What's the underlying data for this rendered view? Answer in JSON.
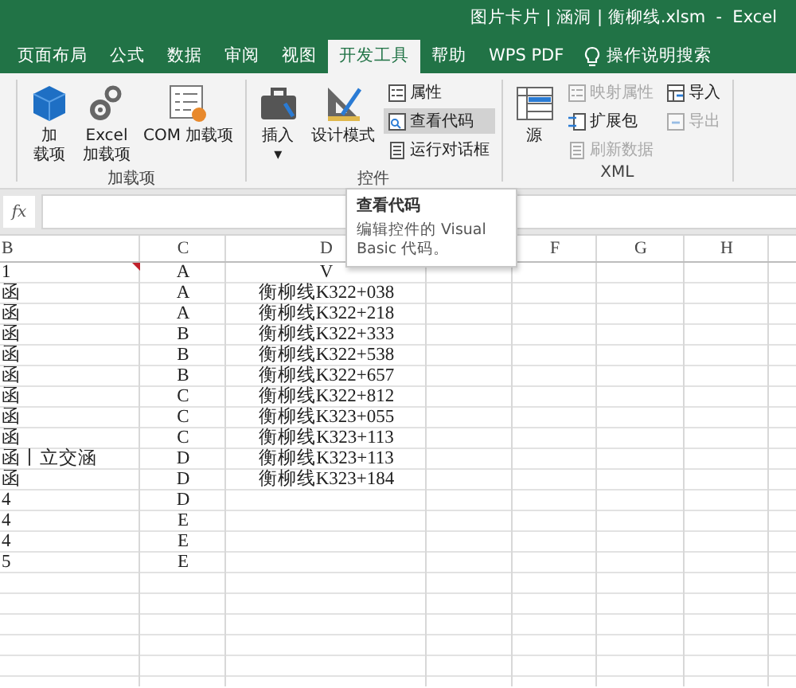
{
  "window": {
    "title": "图片卡片 | 涵洞 | 衡柳线.xlsm  -  Excel"
  },
  "tabs": [
    {
      "label": "页面布局",
      "selected": false
    },
    {
      "label": "公式",
      "selected": false
    },
    {
      "label": "数据",
      "selected": false
    },
    {
      "label": "审阅",
      "selected": false
    },
    {
      "label": "视图",
      "selected": false
    },
    {
      "label": "开发工具",
      "selected": true
    },
    {
      "label": "帮助",
      "selected": false
    },
    {
      "label": "WPS PDF",
      "selected": false
    }
  ],
  "search": {
    "label": "操作说明搜索"
  },
  "ribbon": {
    "groups": [
      {
        "label": "加载项",
        "columns": [
          [
            {
              "kind": "large",
              "lines": [
                "加",
                "载项"
              ],
              "disabled": false,
              "highlighted": false
            }
          ],
          [
            {
              "kind": "large",
              "lines": [
                "Excel",
                "加载项"
              ],
              "disabled": false,
              "highlighted": false
            }
          ],
          [
            {
              "kind": "large",
              "lines": [
                "COM 加载项"
              ],
              "disabled": false,
              "highlighted": false
            }
          ]
        ]
      },
      {
        "label": "控件",
        "columns": [
          [
            {
              "kind": "large",
              "lines": [
                "插入",
                "▾"
              ],
              "disabled": false,
              "highlighted": false
            }
          ],
          [
            {
              "kind": "large",
              "lines": [
                "设计模式"
              ],
              "disabled": false,
              "highlighted": false
            }
          ],
          [
            {
              "kind": "small",
              "lines": [
                "属性"
              ],
              "disabled": false,
              "highlighted": false
            },
            {
              "kind": "small",
              "lines": [
                "查看代码"
              ],
              "disabled": false,
              "highlighted": true
            },
            {
              "kind": "small",
              "lines": [
                "运行对话框"
              ],
              "disabled": false,
              "highlighted": false
            }
          ]
        ]
      },
      {
        "label": "XML",
        "columns": [
          [
            {
              "kind": "large",
              "lines": [
                "源"
              ],
              "disabled": false,
              "highlighted": false
            }
          ],
          [
            {
              "kind": "small",
              "lines": [
                "映射属性"
              ],
              "disabled": true,
              "highlighted": false
            },
            {
              "kind": "small",
              "lines": [
                "扩展包"
              ],
              "disabled": false,
              "highlighted": false
            },
            {
              "kind": "small",
              "lines": [
                "刷新数据"
              ],
              "disabled": true,
              "highlighted": false
            }
          ],
          [
            {
              "kind": "small",
              "lines": [
                "导入"
              ],
              "disabled": false,
              "highlighted": false
            },
            {
              "kind": "small",
              "lines": [
                "导出"
              ],
              "disabled": true,
              "highlighted": false
            }
          ]
        ]
      }
    ]
  },
  "formula_bar": {
    "fx": "fx"
  },
  "tooltip": {
    "title": "查看代码",
    "text": "编辑控件的 Visual Basic 代码。"
  },
  "sheet": {
    "columns": [
      {
        "label": "B"
      },
      {
        "label": "C"
      },
      {
        "label": "D"
      },
      {},
      {
        "label": "F"
      },
      {
        "label": "G"
      },
      {
        "label": "H"
      }
    ],
    "rows": [
      {
        "cells": [
          "1",
          "A",
          "V"
        ],
        "comment": true
      },
      {
        "cells": [
          "函",
          "A",
          "衡柳线K322+038"
        ],
        "comment": false
      },
      {
        "cells": [
          "函",
          "A",
          "衡柳线K322+218"
        ],
        "comment": false
      },
      {
        "cells": [
          "函",
          "B",
          "衡柳线K322+333"
        ],
        "comment": false
      },
      {
        "cells": [
          "函",
          "B",
          "衡柳线K322+538"
        ],
        "comment": false
      },
      {
        "cells": [
          "函",
          "B",
          "衡柳线K322+657"
        ],
        "comment": false
      },
      {
        "cells": [
          "函",
          "C",
          "衡柳线K322+812"
        ],
        "comment": false
      },
      {
        "cells": [
          "函",
          "C",
          "衡柳线K323+055"
        ],
        "comment": false
      },
      {
        "cells": [
          "函",
          "C",
          "衡柳线K323+113"
        ],
        "comment": false
      },
      {
        "cells": [
          "函丨立交涵",
          "D",
          "衡柳线K323+113"
        ],
        "comment": false
      },
      {
        "cells": [
          "函",
          "D",
          "衡柳线K323+184"
        ],
        "comment": false
      },
      {
        "cells": [
          "4",
          "D"
        ],
        "comment": false
      },
      {
        "cells": [
          "4",
          "E"
        ],
        "comment": false
      },
      {
        "cells": [
          "4",
          "E"
        ],
        "comment": false
      },
      {
        "cells": [
          "5",
          "E"
        ],
        "comment": false
      }
    ]
  }
}
